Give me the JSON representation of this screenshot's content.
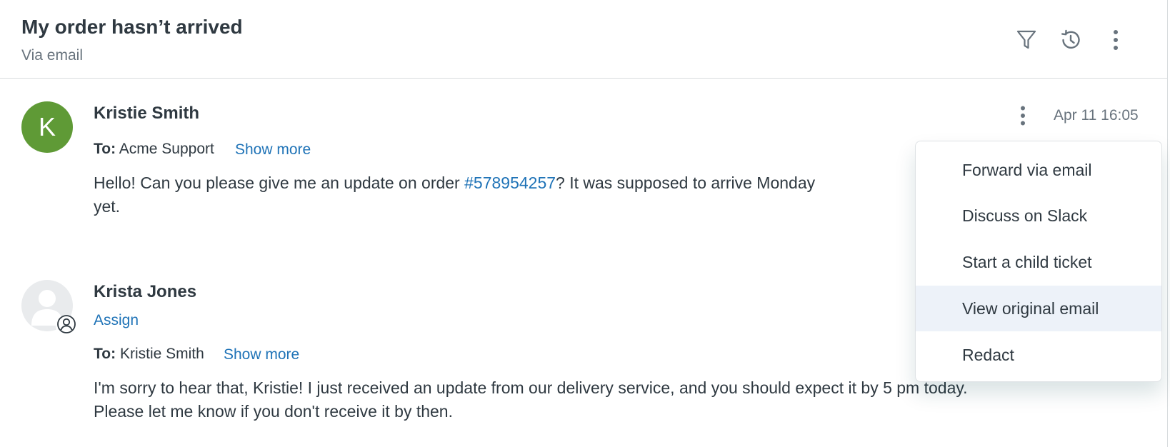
{
  "header": {
    "title": "My order hasn’t arrived",
    "subtitle": "Via email",
    "icons": [
      "filter-icon",
      "history-icon",
      "more-vertical-icon"
    ]
  },
  "messages": [
    {
      "avatar_initial": "K",
      "avatar_color": "#5f9a36",
      "sender": "Kristie Smith",
      "to_label": "To:",
      "to_value": "Acme Support",
      "show_more": "Show more",
      "timestamp": "Apr 11 16:05",
      "body_before": "Hello! Can you please give me an update on order ",
      "body_link": "#578954257",
      "body_after": "? It was supposed to arrive Monday",
      "body_line2": "yet."
    },
    {
      "avatar": "agent-placeholder",
      "sender": "Krista Jones",
      "assign": "Assign",
      "to_label": "To:",
      "to_value": "Kristie Smith",
      "show_more": "Show more",
      "body_line1": "I'm sorry to hear that, Kristie! I just received an update from our delivery service, and you should expect it by 5 pm today.",
      "body_line2": "Please let me know if you don't receive it by then."
    }
  ],
  "menu": {
    "items": [
      {
        "label": "Forward via email"
      },
      {
        "label": "Discuss on Slack"
      },
      {
        "label": "Start a child ticket"
      },
      {
        "label": "View original email",
        "highlighted": true
      },
      {
        "label": "Redact"
      }
    ]
  },
  "colors": {
    "link": "#1f73b7",
    "text": "#2f3941",
    "muted": "#68737d",
    "highlight": "#edf2f9"
  }
}
